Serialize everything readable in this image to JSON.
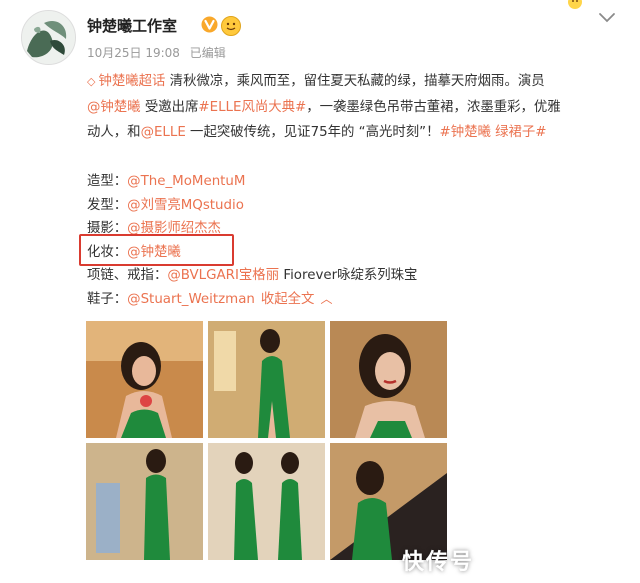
{
  "header": {
    "account_name": "钟楚曦工作室",
    "verified_icon": "verified-v-icon",
    "date": "10月25日 19:08",
    "edited": "已编辑"
  },
  "post": {
    "line1": [
      {
        "text": "钟楚曦超话",
        "link": true
      },
      {
        "text": " 清秋微凉，乘风而至，留住夏天私藏的绿，描摹天府烟雨。演员",
        "link": false
      }
    ],
    "line2": [
      {
        "text": "@钟楚曦",
        "link": true
      },
      {
        "text": " 受邀出席",
        "link": false
      },
      {
        "text": "#ELLE风尚大典#",
        "link": true
      },
      {
        "text": "，一袭墨绿色吊带古董裙，浓墨重彩，优雅",
        "link": false
      }
    ],
    "line3": [
      {
        "text": "动人，和",
        "link": false
      },
      {
        "text": "@ELLE",
        "link": true
      },
      {
        "text": " 一起突破传统，见证75年的 “高光时刻”！",
        "link": false
      },
      {
        "text": "#钟楚曦 绿裙子#",
        "link": true
      }
    ]
  },
  "credits": [
    {
      "label": "造型：",
      "value": "@The_MoMentuM",
      "extra": ""
    },
    {
      "label": "发型：",
      "value": "@刘雪亮MQstudio",
      "extra": ""
    },
    {
      "label": "摄影：",
      "value": "@摄影师绍杰杰",
      "extra": ""
    },
    {
      "label": "化妆：",
      "value": "@钟楚曦",
      "extra": ""
    },
    {
      "label": "项链、戒指：",
      "value": "@BVLGARI宝格丽",
      "extra": " Fiorever咏绽系列珠宝"
    },
    {
      "label": "鞋子：",
      "value": "@Stuart_Weitzman",
      "extra": ""
    }
  ],
  "collapse_label": "收起全文",
  "watermark": "快传号",
  "colors": {
    "link": "#eb7350",
    "highlight_box": "#d93b30",
    "dress_green": "#1f8a3c"
  }
}
